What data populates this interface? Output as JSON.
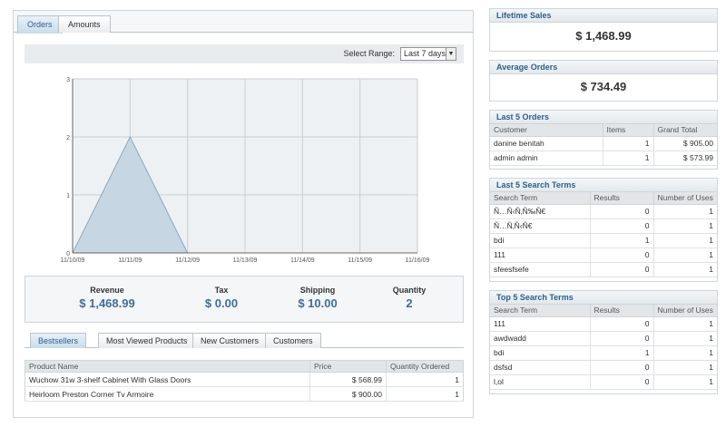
{
  "tabs": [
    "Orders",
    "Amounts"
  ],
  "range": {
    "label": "Select Range:",
    "value": "Last 7 days"
  },
  "chart_data": {
    "type": "area",
    "x": [
      "11/10/09",
      "11/11/09",
      "11/12/09",
      "11/13/09",
      "11/14/09",
      "11/15/09",
      "11/16/09"
    ],
    "values": [
      0,
      2,
      0,
      0,
      0,
      0,
      0
    ],
    "yticks": [
      "0",
      "1",
      "2",
      "3"
    ],
    "ylim": [
      0,
      3
    ],
    "fill_color": "#c6d6e3",
    "line_color": "#8ea8bd"
  },
  "summary": [
    {
      "label": "Revenue",
      "value": "$ 1,468.99"
    },
    {
      "label": "Tax",
      "value": "$ 0.00"
    },
    {
      "label": "Shipping",
      "value": "$ 10.00"
    },
    {
      "label": "Quantity",
      "value": "2"
    }
  ],
  "bottom_tabs": [
    "Bestsellers",
    "Most Viewed Products",
    "New Customers",
    "Customers"
  ],
  "bestsellers": {
    "headers": [
      "Product Name",
      "Price",
      "Quantity Ordered"
    ],
    "rows": [
      [
        "Wuchow 31w 3-shelf Cabinet With Glass Doors",
        "$ 568.99",
        "1"
      ],
      [
        "Heirloom Preston Corner Tv Armoire",
        "$ 900.00",
        "1"
      ]
    ]
  },
  "lifetime_sales": {
    "title": "Lifetime Sales",
    "value": "$ 1,468.99"
  },
  "average_orders": {
    "title": "Average Orders",
    "value": "$ 734.49"
  },
  "last_orders": {
    "title": "Last 5 Orders",
    "headers": [
      "Customer",
      "Items",
      "Grand Total"
    ],
    "rows": [
      [
        "danine benitah",
        "1",
        "$ 905.00"
      ],
      [
        "admin admin",
        "1",
        "$ 573.99"
      ]
    ]
  },
  "last_search": {
    "title": "Last 5 Search Terms",
    "headers": [
      "Search Term",
      "Results",
      "Number of Uses"
    ],
    "rows": [
      [
        "Ñ…Ñ‹Ñ‚Ñ‰Ñ€",
        "0",
        "1"
      ],
      [
        "Ñ…Ñ‚Ñ‹Ñ€",
        "0",
        "1"
      ],
      [
        "bdi",
        "1",
        "1"
      ],
      [
        "111",
        "0",
        "1"
      ],
      [
        "sfeesfsefe",
        "0",
        "1"
      ]
    ]
  },
  "top_search": {
    "title": "Top 5 Search Terms",
    "headers": [
      "Search Term",
      "Results",
      "Number of Uses"
    ],
    "rows": [
      [
        "111",
        "0",
        "1"
      ],
      [
        "awdwadd",
        "0",
        "1"
      ],
      [
        "bdi",
        "1",
        "1"
      ],
      [
        "dsfsd",
        "0",
        "1"
      ],
      [
        "l,ol",
        "0",
        "1"
      ]
    ]
  }
}
